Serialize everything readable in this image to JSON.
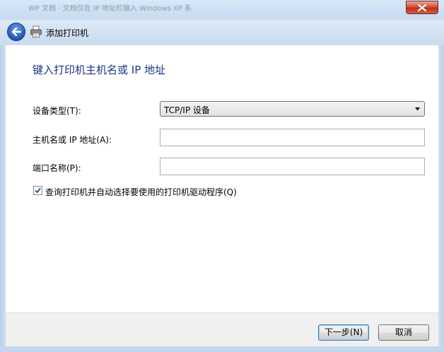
{
  "window": {
    "blurred_title": "WP 文档 · 文档仅在 IP 地址栏输入 Windows XP 系"
  },
  "nav": {
    "title": "添加打印机"
  },
  "form": {
    "heading": "键入打印机主机名或 IP 地址",
    "device_type_label": "设备类型(T):",
    "device_type_value": "TCP/IP 设备",
    "host_label": "主机名或 IP 地址(A):",
    "host_value": "",
    "port_label": "端口名称(P):",
    "port_value": "",
    "query_checkbox_label": "查询打印机并自动选择要使用的打印机驱动程序(Q)",
    "query_checkbox_checked": true
  },
  "footer": {
    "next_label": "下一步(N)",
    "cancel_label": "取消"
  },
  "icons": {
    "back": "back-arrow-icon",
    "printer": "printer-icon",
    "close": "close-icon",
    "dropdown": "chevron-down-icon",
    "check": "check-icon"
  }
}
